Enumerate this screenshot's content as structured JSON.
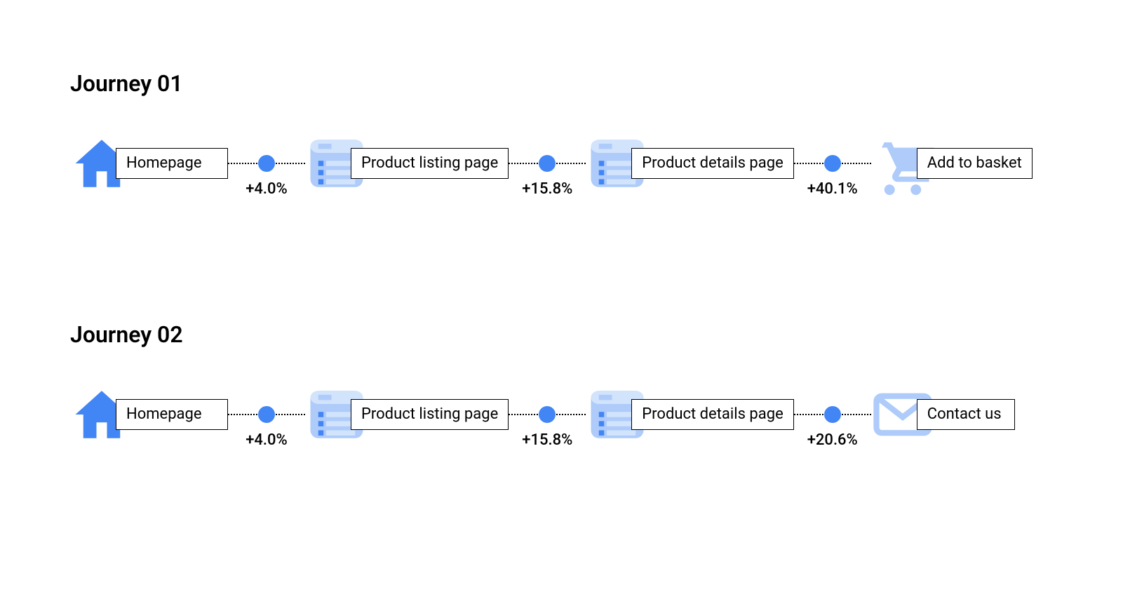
{
  "journeys": [
    {
      "title": "Journey 01",
      "steps": [
        {
          "icon": "home",
          "label": "Homepage"
        },
        {
          "icon": "list",
          "label": "Product listing page"
        },
        {
          "icon": "list",
          "label": "Product details page"
        },
        {
          "icon": "cart",
          "label": "Add to basket"
        }
      ],
      "connectors": [
        "+4.0%",
        "+15.8%",
        "+40.1%"
      ]
    },
    {
      "title": "Journey 02",
      "steps": [
        {
          "icon": "home",
          "label": "Homepage"
        },
        {
          "icon": "list",
          "label": "Product listing page"
        },
        {
          "icon": "list",
          "label": "Product details page"
        },
        {
          "icon": "mail",
          "label": "Contact us"
        }
      ],
      "connectors": [
        "+4.0%",
        "+15.8%",
        "+20.6%"
      ]
    }
  ]
}
